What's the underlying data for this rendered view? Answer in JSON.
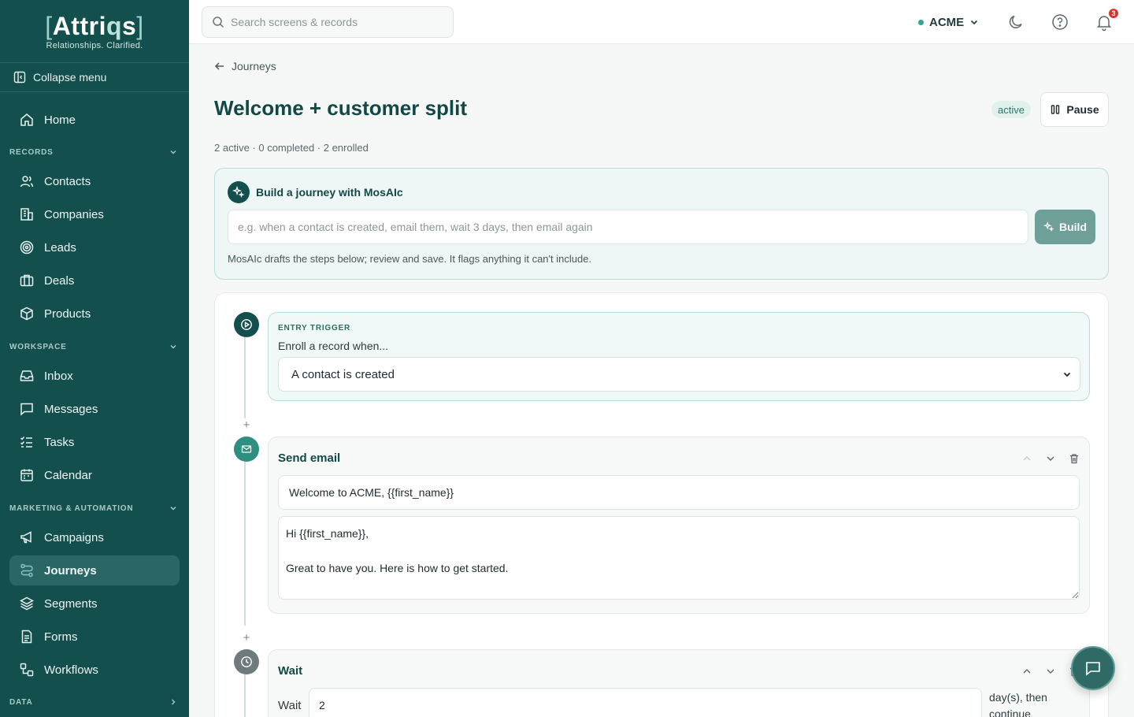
{
  "brand": {
    "name_prefix": "[",
    "name_main": "Attri",
    "name_q": "q",
    "name_end": "s",
    "name_suffix": "]",
    "tagline": "Relationships. Clarified."
  },
  "sidebar": {
    "collapse_label": "Collapse menu",
    "home_label": "Home",
    "records_header": "RECORDS",
    "records": [
      {
        "label": "Contacts",
        "icon": "users-icon"
      },
      {
        "label": "Companies",
        "icon": "building-icon"
      },
      {
        "label": "Leads",
        "icon": "target-icon"
      },
      {
        "label": "Deals",
        "icon": "briefcase-icon"
      },
      {
        "label": "Products",
        "icon": "package-icon"
      }
    ],
    "workspace_header": "WORKSPACE",
    "workspace": [
      {
        "label": "Inbox",
        "icon": "inbox-icon"
      },
      {
        "label": "Messages",
        "icon": "message-icon"
      },
      {
        "label": "Tasks",
        "icon": "checklist-icon"
      },
      {
        "label": "Calendar",
        "icon": "calendar-icon"
      }
    ],
    "marketing_header": "MARKETING & AUTOMATION",
    "marketing": [
      {
        "label": "Campaigns",
        "icon": "megaphone-icon"
      },
      {
        "label": "Journeys",
        "icon": "route-icon",
        "active": true
      },
      {
        "label": "Segments",
        "icon": "layers-icon"
      },
      {
        "label": "Forms",
        "icon": "form-icon"
      },
      {
        "label": "Workflows",
        "icon": "workflow-icon"
      }
    ],
    "data_header": "DATA"
  },
  "topbar": {
    "search_placeholder": "Search screens & records",
    "org_name": "ACME",
    "notification_count": "3"
  },
  "page": {
    "back_label": "Journeys",
    "title": "Welcome + customer split",
    "stats": "2 active · 0 completed · 2 enrolled",
    "status": "active",
    "pause_label": "Pause"
  },
  "builder": {
    "title": "Build a journey with MosAIc",
    "placeholder": "e.g. when a contact is created, email them, wait 3 days, then email again",
    "build_label": "Build",
    "note": "MosAIc drafts the steps below; review and save. It flags anything it can't include."
  },
  "trigger": {
    "eyebrow": "ENTRY TRIGGER",
    "label": "Enroll a record when...",
    "selected": "A contact is created"
  },
  "steps": {
    "email_title": "Send email",
    "email_subject": "Welcome to ACME, {{first_name}}",
    "email_body": "Hi {{first_name}},\n\nGreat to have you. Here is how to get started.",
    "wait_title": "Wait",
    "wait_label": "Wait",
    "wait_value": "2",
    "wait_suffix": "day(s), then continue"
  },
  "colors": {
    "sidebar_bg": "#134f4c",
    "accent": "#2fa694",
    "title_text": "#124845",
    "notification_badge": "#d9352f"
  }
}
